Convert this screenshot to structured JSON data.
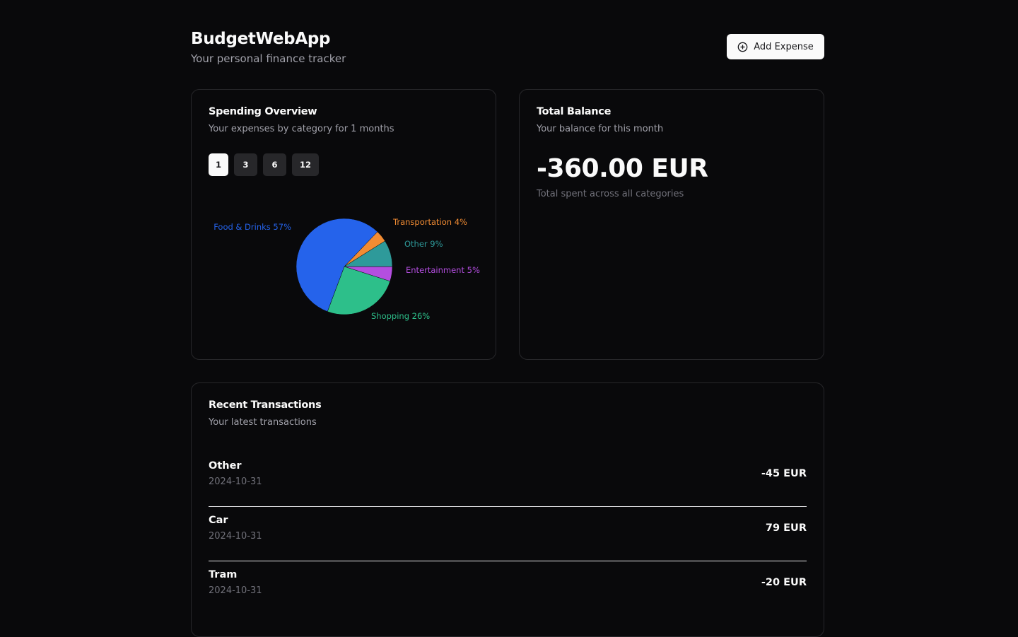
{
  "app": {
    "title": "BudgetWebApp",
    "subtitle": "Your personal finance tracker",
    "add_expense_label": "Add Expense",
    "add_expense_icon": "plus-circle-icon"
  },
  "spending": {
    "title": "Spending Overview",
    "description": "Your expenses by category for 1 months",
    "periods": [
      "1",
      "3",
      "6",
      "12"
    ],
    "active_period": "1"
  },
  "chart_data": {
    "type": "pie",
    "slices": [
      {
        "label": "Food & Drinks",
        "value": 57,
        "color": "#2563eb",
        "text": "Food & Drinks 57%"
      },
      {
        "label": "Transportation",
        "value": 4,
        "color": "#f28c33",
        "text": "Transportation 4%"
      },
      {
        "label": "Other",
        "value": 9,
        "color": "#2e9a9a",
        "text": "Other 9%"
      },
      {
        "label": "Entertainment",
        "value": 5,
        "color": "#b44ee0",
        "text": "Entertainment 5%"
      },
      {
        "label": "Shopping",
        "value": 26,
        "color": "#2dbf8a",
        "text": "Shopping 26%"
      }
    ]
  },
  "balance": {
    "title": "Total Balance",
    "description": "Your balance for this month",
    "amount": "-360.00 EUR",
    "note": "Total spent across all categories"
  },
  "transactions": {
    "title": "Recent Transactions",
    "description": "Your latest transactions",
    "items": [
      {
        "name": "Other",
        "date": "2024-10-31",
        "amount": "-45 EUR"
      },
      {
        "name": "Car",
        "date": "2024-10-31",
        "amount": "79 EUR"
      },
      {
        "name": "Tram",
        "date": "2024-10-31",
        "amount": "-20 EUR"
      }
    ]
  }
}
